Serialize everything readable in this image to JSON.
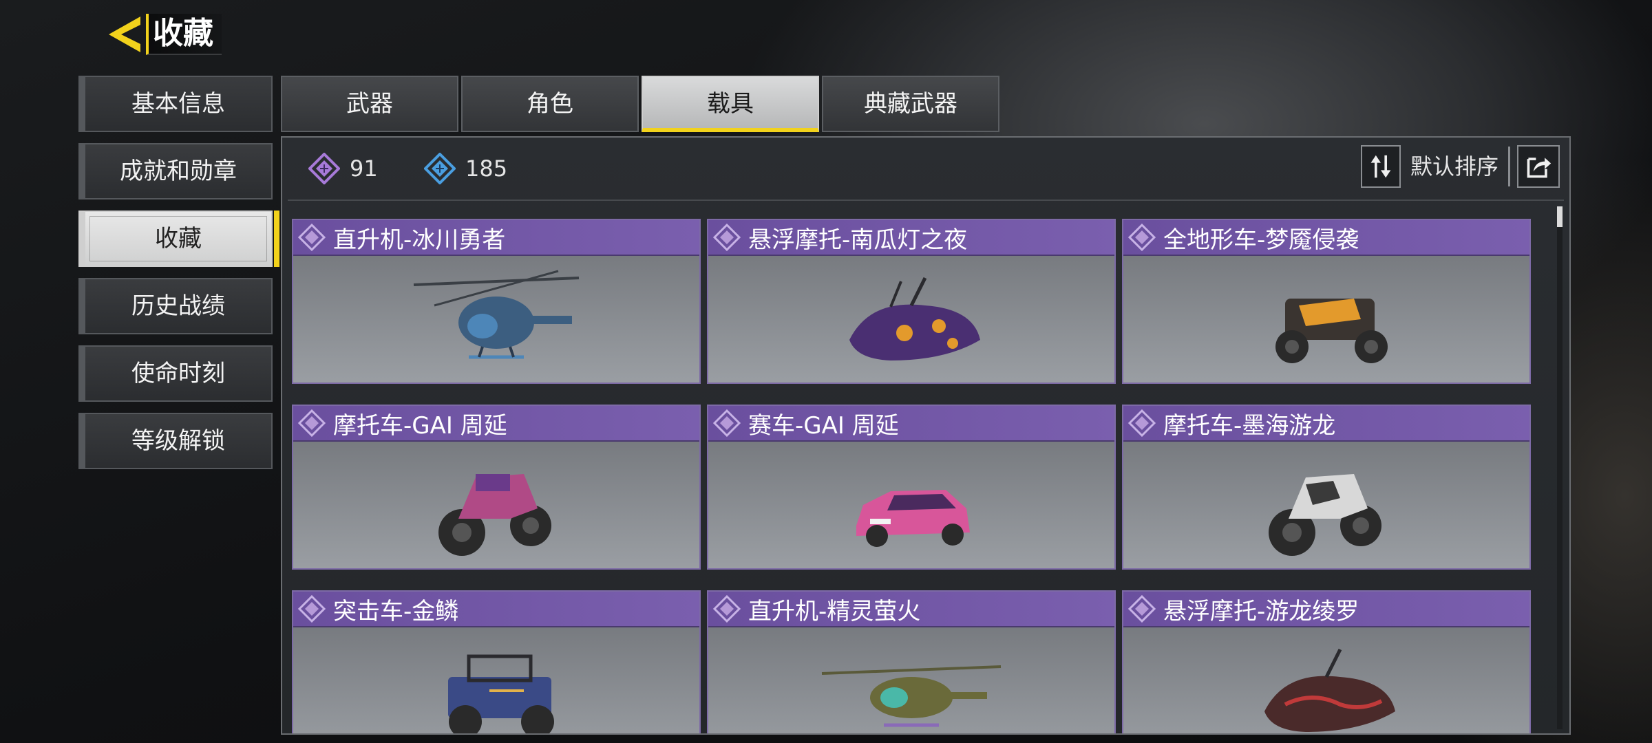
{
  "header": {
    "title": "收藏"
  },
  "sidebar": {
    "items": [
      {
        "label": "基本信息"
      },
      {
        "label": "成就和勋章"
      },
      {
        "label": "收藏",
        "active": true
      },
      {
        "label": "历史战绩"
      },
      {
        "label": "使命时刻"
      },
      {
        "label": "等级解锁"
      }
    ]
  },
  "tabs": [
    {
      "label": "武器"
    },
    {
      "label": "角色"
    },
    {
      "label": "载具",
      "active": true
    },
    {
      "label": "典藏武器"
    }
  ],
  "stats": {
    "purple_count": "91",
    "blue_count": "185"
  },
  "sort": {
    "label": "默认排序"
  },
  "vehicles": [
    {
      "title": "直升机-冰川勇者",
      "kind": "helicopter",
      "color": "#4d86b8"
    },
    {
      "title": "悬浮摩托-南瓜灯之夜",
      "kind": "hoverbike",
      "color": "#5a3a86"
    },
    {
      "title": "全地形车-梦魇侵袭",
      "kind": "atv",
      "color": "#e39a2c"
    },
    {
      "title": "摩托车-GAI 周延",
      "kind": "motorcycle",
      "color": "#b04a86"
    },
    {
      "title": "赛车-GAI 周延",
      "kind": "car",
      "color": "#d8569a"
    },
    {
      "title": "摩托车-墨海游龙",
      "kind": "motorcycle",
      "color": "#d8d8d8"
    },
    {
      "title": "突击车-金鳞",
      "kind": "buggy",
      "color": "#3a4a86"
    },
    {
      "title": "直升机-精灵萤火",
      "kind": "helicopter",
      "color": "#8a8a4a"
    },
    {
      "title": "悬浮摩托-游龙绫罗",
      "kind": "hoverbike",
      "color": "#a03030"
    }
  ],
  "colors": {
    "accent": "#f2d21c",
    "card_header": "#6a4f9e",
    "diamond_purple": "#a77ad8",
    "diamond_blue": "#4a9ee0"
  }
}
